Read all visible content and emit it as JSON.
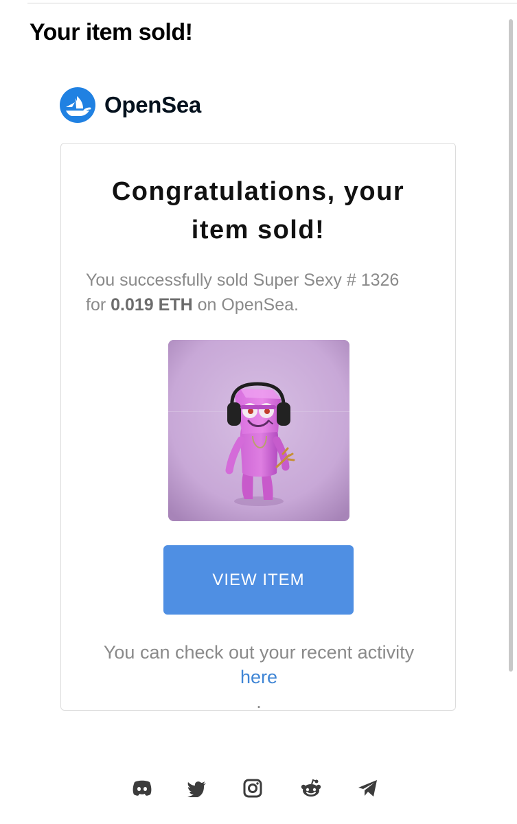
{
  "email": {
    "subject": "Your item sold!"
  },
  "brand": {
    "name": "OpenSea",
    "logo_icon": "opensea-ship-icon",
    "brand_color": "#2081e2"
  },
  "card": {
    "headline_lines": [
      "Congratulations, your",
      "item sold!"
    ],
    "summary": {
      "prefix": "You successfully sold Super Sexy #",
      "token_number": "1326",
      "for_text": "for",
      "price": "0.019 ETH",
      "suffix": "on OpenSea."
    },
    "button_label": "VIEW ITEM",
    "activity_text": "You can check out your recent activity",
    "activity_link": "here",
    "activity_end": "."
  },
  "footer": {
    "social_icons": [
      "discord-icon",
      "twitter-icon",
      "instagram-icon",
      "reddit-icon",
      "telegram-icon"
    ]
  },
  "colors": {
    "button": "#4f8fe3",
    "link": "#3f85d5",
    "muted_text": "#8a8a8a",
    "nft_background": "#c7a9d6"
  }
}
